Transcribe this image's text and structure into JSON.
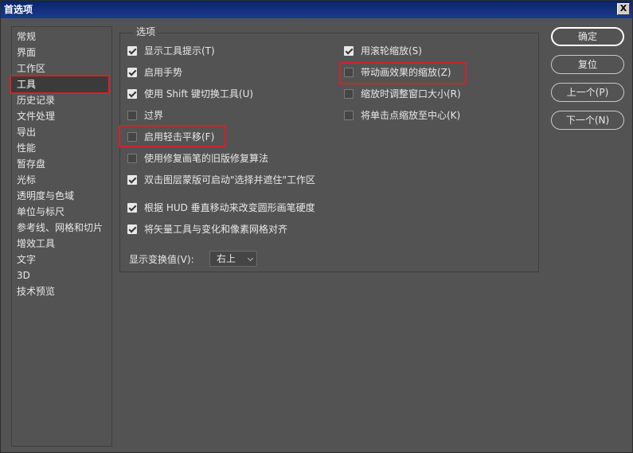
{
  "window": {
    "title": "首选项",
    "close_label": "X"
  },
  "sidebar": {
    "items": [
      {
        "label": "常规"
      },
      {
        "label": "界面"
      },
      {
        "label": "工作区"
      },
      {
        "label": "工具",
        "selected": true
      },
      {
        "label": "历史记录"
      },
      {
        "label": "文件处理"
      },
      {
        "label": "导出"
      },
      {
        "label": "性能"
      },
      {
        "label": "暂存盘"
      },
      {
        "label": "光标"
      },
      {
        "label": "透明度与色域"
      },
      {
        "label": "单位与标尺"
      },
      {
        "label": "参考线、网格和切片"
      },
      {
        "label": "增效工具"
      },
      {
        "label": "文字"
      },
      {
        "label": "3D"
      },
      {
        "label": "技术预览"
      }
    ]
  },
  "options": {
    "legend": "选项",
    "left": [
      {
        "label": "显示工具提示(T)",
        "checked": true
      },
      {
        "label": "启用手势",
        "checked": true
      },
      {
        "label": "使用 Shift 键切换工具(U)",
        "checked": true
      },
      {
        "label": "过界",
        "checked": false
      },
      {
        "label": "启用轻击平移(F)",
        "checked": false
      },
      {
        "label": "使用修复画笔的旧版修复算法",
        "checked": false
      },
      {
        "label": "双击图层蒙版可启动\"选择并遮住\"工作区",
        "checked": true
      },
      {
        "label": "根据 HUD 垂直移动来改变圆形画笔硬度",
        "checked": true
      },
      {
        "label": "将矢量工具与变化和像素网格对齐",
        "checked": true
      }
    ],
    "right": [
      {
        "label": "用滚轮缩放(S)",
        "checked": true
      },
      {
        "label": "带动画效果的缩放(Z)",
        "checked": false
      },
      {
        "label": "缩放时调整窗口大小(R)",
        "checked": false
      },
      {
        "label": "将单击点缩放至中心(K)",
        "checked": false
      }
    ],
    "transform_values": {
      "label": "显示变换值(V):",
      "value": "右上"
    }
  },
  "buttons": {
    "ok": "确定",
    "reset": "复位",
    "prev": "上一个(P)",
    "next": "下一个(N)"
  },
  "colors": {
    "highlight": "#d0232a",
    "background": "#535353"
  }
}
